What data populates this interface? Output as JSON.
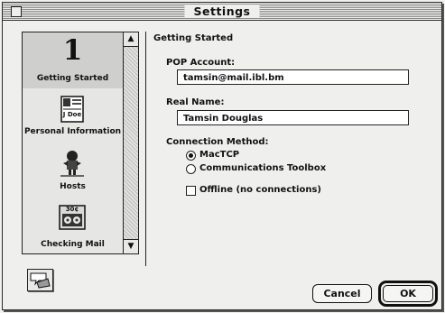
{
  "window": {
    "title": "Settings"
  },
  "sidebar": {
    "items": [
      {
        "label": "Getting Started",
        "glyph": "1",
        "icon": "number-one-icon",
        "selected": true
      },
      {
        "label": "Personal Information",
        "icon": "personal-card-icon",
        "card_text": "J Doe"
      },
      {
        "label": "Hosts",
        "icon": "hosts-icon"
      },
      {
        "label": "Checking Mail",
        "icon": "checking-mail-icon",
        "tape_text": "30¢"
      }
    ]
  },
  "panel": {
    "section_title": "Getting Started",
    "pop_account": {
      "label": "POP Account:",
      "value": "tamsin@mail.ibl.bm"
    },
    "real_name": {
      "label": "Real Name:",
      "value": "Tamsin Douglas"
    },
    "connection": {
      "label": "Connection Method:",
      "options": [
        {
          "label": "MacTCP",
          "selected": true
        },
        {
          "label": "Communications Toolbox",
          "selected": false
        }
      ],
      "offline": {
        "label": "Offline (no connections)",
        "checked": false
      }
    }
  },
  "buttons": {
    "cancel": "Cancel",
    "ok": "OK"
  },
  "help": {
    "icon": "balloon-help-icon"
  }
}
